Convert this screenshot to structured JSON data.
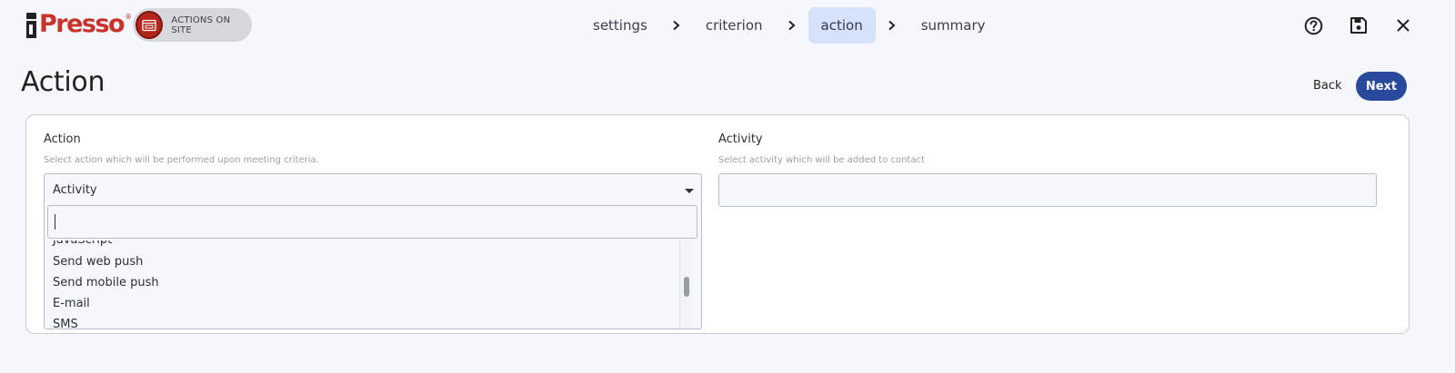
{
  "header": {
    "logo_text": "Presso",
    "logo_reg": "®",
    "badge_label": "ACTIONS ON SITE",
    "steps": [
      {
        "label": "settings"
      },
      {
        "label": "criterion"
      },
      {
        "label": "action",
        "active": true
      },
      {
        "label": "summary"
      }
    ],
    "icons": [
      "help-icon",
      "save-icon",
      "close-icon"
    ]
  },
  "page": {
    "title": "Action",
    "back_label": "Back",
    "next_label": "Next"
  },
  "form": {
    "action": {
      "label": "Action",
      "help": "Select action which will be performed upon meeting criteria.",
      "selected": "Activity",
      "search_value": "",
      "options": [
        "JavaScript",
        "Send web push",
        "Send mobile push",
        "E-mail",
        "SMS"
      ]
    },
    "activity": {
      "label": "Activity",
      "help": "Select activity which will be added to contact",
      "value": ""
    }
  },
  "colors": {
    "brand_red": "#c8332b",
    "primary": "#294a9c",
    "active_step_bg": "#d6e2fa"
  }
}
